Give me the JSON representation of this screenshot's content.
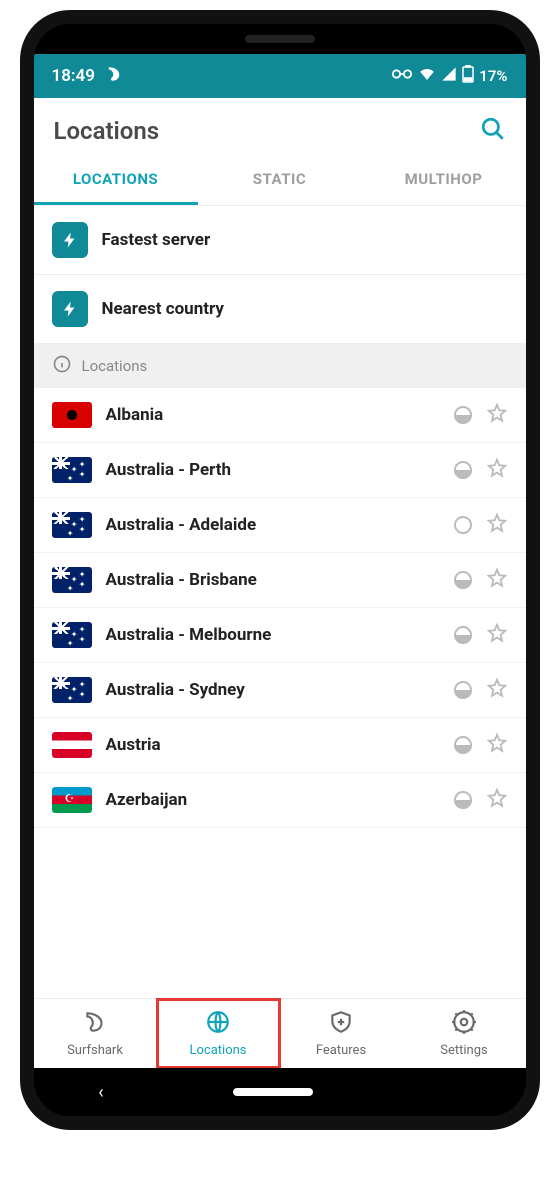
{
  "statusbar": {
    "time": "18:49",
    "battery": "17%"
  },
  "header": {
    "title": "Locations"
  },
  "tabs": [
    {
      "label": "LOCATIONS",
      "active": true
    },
    {
      "label": "STATIC",
      "active": false
    },
    {
      "label": "MULTIHOP",
      "active": false
    }
  ],
  "quick": [
    {
      "label": "Fastest server"
    },
    {
      "label": "Nearest country"
    }
  ],
  "section": {
    "label": "Locations"
  },
  "locations": [
    {
      "name": "Albania",
      "flag": "al",
      "load": "half"
    },
    {
      "name": "Australia - Perth",
      "flag": "au",
      "load": "half"
    },
    {
      "name": "Australia - Adelaide",
      "flag": "au",
      "load": "empty"
    },
    {
      "name": "Australia - Brisbane",
      "flag": "au",
      "load": "half"
    },
    {
      "name": "Australia - Melbourne",
      "flag": "au",
      "load": "half"
    },
    {
      "name": "Australia - Sydney",
      "flag": "au",
      "load": "half"
    },
    {
      "name": "Austria",
      "flag": "at",
      "load": "half"
    },
    {
      "name": "Azerbaijan",
      "flag": "az",
      "load": "half"
    }
  ],
  "bottomnav": [
    {
      "label": "Surfshark",
      "icon": "shark",
      "active": false,
      "highlighted": false
    },
    {
      "label": "Locations",
      "icon": "globe",
      "active": true,
      "highlighted": true
    },
    {
      "label": "Features",
      "icon": "shield",
      "active": false,
      "highlighted": false
    },
    {
      "label": "Settings",
      "icon": "gear",
      "active": false,
      "highlighted": false
    }
  ]
}
